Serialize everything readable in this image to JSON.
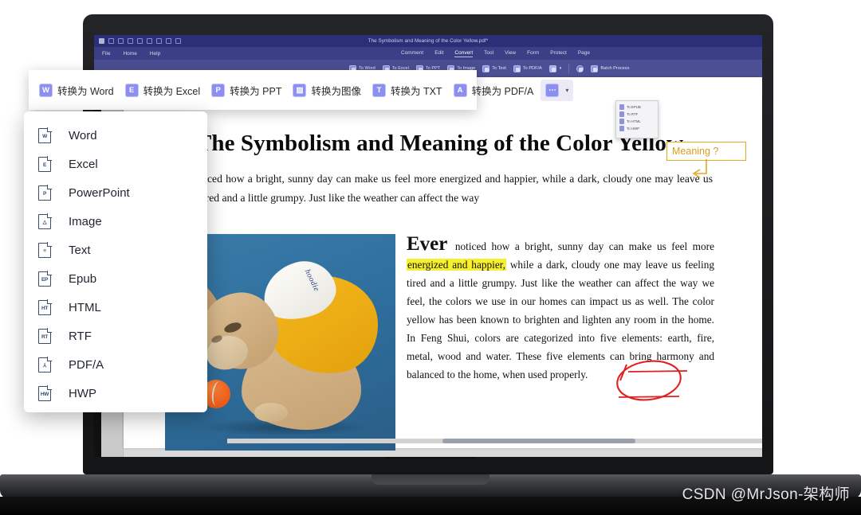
{
  "app": {
    "title": "The Symbolism and Meaning of the Color Yellow.pdf*",
    "menu_left": [
      "File",
      "Home",
      "Help"
    ],
    "menu_center": [
      "Comment",
      "Edit",
      "Convert",
      "Tool",
      "View",
      "Form",
      "Protect",
      "Page"
    ],
    "active_menu": "Convert",
    "ribbon": [
      {
        "icon": "to-word-icon",
        "label": "To Word"
      },
      {
        "icon": "to-excel-icon",
        "label": "To Excel"
      },
      {
        "icon": "to-ppt-icon",
        "label": "To PPT"
      },
      {
        "icon": "to-image-icon",
        "label": "To Image"
      },
      {
        "icon": "to-text-icon",
        "label": "To Text"
      },
      {
        "icon": "to-pdfa-icon",
        "label": "To PDF/A"
      }
    ],
    "ribbon_more_label": "",
    "ribbon_settings_label": "",
    "ribbon_batch_label": "Batch Process",
    "mini_dropdown": [
      {
        "icon": "to-epub-icon",
        "label": "To EPUB"
      },
      {
        "icon": "to-rtf-icon",
        "label": "To RTF"
      },
      {
        "icon": "to-html-icon",
        "label": "To HTML"
      },
      {
        "icon": "to-hwp-icon",
        "label": "To HWP"
      }
    ]
  },
  "overlay_toolbar": {
    "buttons": [
      {
        "icon": "word-icon",
        "glyph": "W",
        "label": "转换为 Word"
      },
      {
        "icon": "excel-icon",
        "glyph": "E",
        "label": "转换为 Excel"
      },
      {
        "icon": "ppt-icon",
        "glyph": "P",
        "label": "转换为 PPT"
      },
      {
        "icon": "image-icon",
        "glyph": "▨",
        "label": "转换为图像"
      },
      {
        "icon": "text-icon",
        "glyph": "T",
        "label": "转换为 TXT"
      },
      {
        "icon": "pdfa-icon",
        "glyph": "A",
        "label": "转换为 PDF/A"
      }
    ],
    "more_glyph": "⋯",
    "more_caret": "▾"
  },
  "format_menu": {
    "items": [
      {
        "icon": "word-doc-icon",
        "glyph": "W",
        "label": "Word"
      },
      {
        "icon": "excel-doc-icon",
        "glyph": "E",
        "label": "Excel"
      },
      {
        "icon": "powerpoint-doc-icon",
        "glyph": "P",
        "label": "PowerPoint"
      },
      {
        "icon": "image-doc-icon",
        "glyph": "△",
        "label": "Image"
      },
      {
        "icon": "text-doc-icon",
        "glyph": "≡",
        "label": "Text"
      },
      {
        "icon": "epub-doc-icon",
        "glyph": "EP",
        "label": "Epub"
      },
      {
        "icon": "html-doc-icon",
        "glyph": "HT",
        "label": "HTML"
      },
      {
        "icon": "rtf-doc-icon",
        "glyph": "RT",
        "label": "RTF"
      },
      {
        "icon": "pdfa-doc-icon",
        "glyph": "⅄",
        "label": "PDF/A"
      },
      {
        "icon": "hwp-doc-icon",
        "glyph": "HW",
        "label": "HWP"
      }
    ]
  },
  "document": {
    "title": "The Symbolism and Meaning of the Color Yellow",
    "lead_paragraph": "Ever noticed how a bright, sunny day can make us feel more energized and happier, while a dark, cloudy one may leave us feeling tired and a little grumpy. Just like the weather can affect the way",
    "lead_ellipsis": "…",
    "body_dropcap": "Ever",
    "body_part1": " noticed how a bright, sunny day can make us feel more ",
    "body_highlight": "energized and happier,",
    "body_part2": " while a dark, cloudy one may leave us feeling tired and a little grumpy. Just like the weather can affect the way we feel, the colors we use in our homes can impact us as well. The color yellow has been known to brighten and lighten any room in the home. In Feng Shui, colors are categorized into five elements: earth, fire, metal, wood and water. These five elements can bring harmony and balanced to the home, when used properly.",
    "image_alt": "French bulldog wearing a yellow hoodie on a blue background with an orange tennis ball",
    "hood_script": "hoodie"
  },
  "annotations": {
    "callout_text": "Meaning ?",
    "callout_color": "#d99c1e",
    "highlight_color": "#f7f02f",
    "circle_color": "#e02020"
  },
  "watermark": "CSDN @MrJson-架构师"
}
